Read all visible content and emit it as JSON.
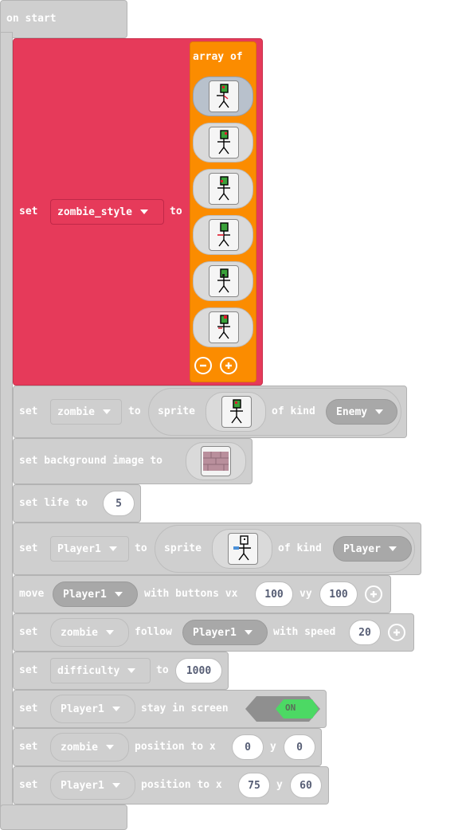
{
  "hat": {
    "label": "on start"
  },
  "block_zombie_style": {
    "set": "set",
    "variable": "zombie_style",
    "to": "to",
    "array_label": "array of",
    "image_count": 6
  },
  "block_zombie": {
    "set": "set",
    "variable": "zombie",
    "to": "to",
    "sprite": "sprite",
    "of_kind": "of kind",
    "kind": "Enemy"
  },
  "block_background": {
    "label": "set background image to"
  },
  "block_life": {
    "label": "set life to",
    "value": "5"
  },
  "block_player1": {
    "set": "set",
    "variable": "Player1",
    "to": "to",
    "sprite": "sprite",
    "of_kind": "of kind",
    "kind": "Player"
  },
  "block_move": {
    "move": "move",
    "variable": "Player1",
    "with_buttons": "with buttons vx",
    "vx": "100",
    "vy_label": "vy",
    "vy": "100"
  },
  "block_follow": {
    "set": "set",
    "variable": "zombie",
    "follow": "follow",
    "target": "Player1",
    "with_speed": "with speed",
    "speed": "20"
  },
  "block_difficulty": {
    "set": "set",
    "variable": "difficulty",
    "to": "to",
    "value": "1000"
  },
  "block_stay": {
    "set": "set",
    "variable": "Player1",
    "stay": "stay in screen",
    "toggle": "ON"
  },
  "block_zombie_pos": {
    "set": "set",
    "variable": "zombie",
    "position_to": "position to x",
    "x": "0",
    "y_label": "y",
    "y": "0"
  },
  "block_player_pos": {
    "set": "set",
    "variable": "Player1",
    "position_to": "position to x",
    "x": "75",
    "y_label": "y",
    "y": "60"
  },
  "colors": {
    "variables_red": "#e63a5a",
    "array_orange": "#fb8c00",
    "block_gray": "#cfcfcf",
    "toggle_green": "#4cd964"
  }
}
